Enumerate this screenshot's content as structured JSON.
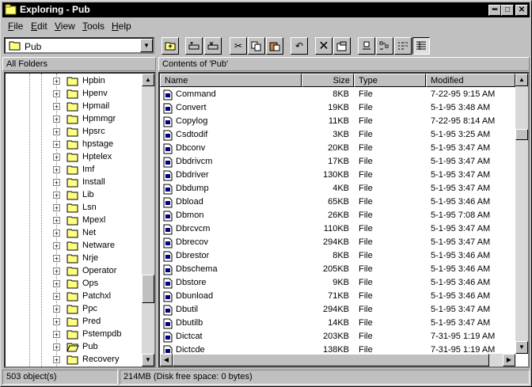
{
  "window": {
    "title": "Exploring - Pub"
  },
  "menu": [
    {
      "label": "File",
      "key": "F",
      "rest": "ile"
    },
    {
      "label": "Edit",
      "key": "E",
      "rest": "dit"
    },
    {
      "label": "View",
      "key": "V",
      "rest": "iew"
    },
    {
      "label": "Tools",
      "key": "T",
      "rest": "ools"
    },
    {
      "label": "Help",
      "key": "H",
      "rest": "elp"
    }
  ],
  "address": {
    "value": "Pub"
  },
  "left_header": "All Folders",
  "right_header": "Contents of 'Pub'",
  "folders": [
    "Hpbin",
    "Hpenv",
    "Hpmail",
    "Hpmmgr",
    "Hpsrc",
    "hpstage",
    "Hptelex",
    "Imf",
    "Install",
    "Lib",
    "Lsn",
    "Mpexl",
    "Net",
    "Netware",
    "Nrje",
    "Operator",
    "Ops",
    "Patchxl",
    "Ppc",
    "Pred",
    "Pstempdb",
    "Pub",
    "Recovery"
  ],
  "selected_folder": "Pub",
  "columns": [
    "Name",
    "Size",
    "Type",
    "Modified"
  ],
  "files": [
    {
      "name": "Command",
      "size": "8KB",
      "type": "File",
      "modified": "7-22-95 9:15 AM"
    },
    {
      "name": "Convert",
      "size": "19KB",
      "type": "File",
      "modified": "5-1-95 3:48 AM"
    },
    {
      "name": "Copylog",
      "size": "11KB",
      "type": "File",
      "modified": "7-22-95 8:14 AM"
    },
    {
      "name": "Csdtodif",
      "size": "3KB",
      "type": "File",
      "modified": "5-1-95 3:25 AM"
    },
    {
      "name": "Dbconv",
      "size": "20KB",
      "type": "File",
      "modified": "5-1-95 3:47 AM"
    },
    {
      "name": "Dbdrivcm",
      "size": "17KB",
      "type": "File",
      "modified": "5-1-95 3:47 AM"
    },
    {
      "name": "Dbdriver",
      "size": "130KB",
      "type": "File",
      "modified": "5-1-95 3:47 AM"
    },
    {
      "name": "Dbdump",
      "size": "4KB",
      "type": "File",
      "modified": "5-1-95 3:47 AM"
    },
    {
      "name": "Dbload",
      "size": "65KB",
      "type": "File",
      "modified": "5-1-95 3:46 AM"
    },
    {
      "name": "Dbmon",
      "size": "26KB",
      "type": "File",
      "modified": "5-1-95 7:08 AM"
    },
    {
      "name": "Dbrcvcm",
      "size": "110KB",
      "type": "File",
      "modified": "5-1-95 3:47 AM"
    },
    {
      "name": "Dbrecov",
      "size": "294KB",
      "type": "File",
      "modified": "5-1-95 3:47 AM"
    },
    {
      "name": "Dbrestor",
      "size": "8KB",
      "type": "File",
      "modified": "5-1-95 3:46 AM"
    },
    {
      "name": "Dbschema",
      "size": "205KB",
      "type": "File",
      "modified": "5-1-95 3:46 AM"
    },
    {
      "name": "Dbstore",
      "size": "9KB",
      "type": "File",
      "modified": "5-1-95 3:46 AM"
    },
    {
      "name": "Dbunload",
      "size": "71KB",
      "type": "File",
      "modified": "5-1-95 3:46 AM"
    },
    {
      "name": "Dbutil",
      "size": "294KB",
      "type": "File",
      "modified": "5-1-95 3:47 AM"
    },
    {
      "name": "Dbutilb",
      "size": "14KB",
      "type": "File",
      "modified": "5-1-95 3:47 AM"
    },
    {
      "name": "Dictcat",
      "size": "203KB",
      "type": "File",
      "modified": "7-31-95 1:19 AM"
    },
    {
      "name": "Dictcde",
      "size": "138KB",
      "type": "File",
      "modified": "7-31-95 1:19 AM"
    }
  ],
  "status": {
    "objects": "503 object(s)",
    "disk": "214MB (Disk free space: 0 bytes)"
  },
  "colors": {
    "titlebar": "#000000",
    "face": "#c0c0c0",
    "pane": "#ffffff"
  }
}
